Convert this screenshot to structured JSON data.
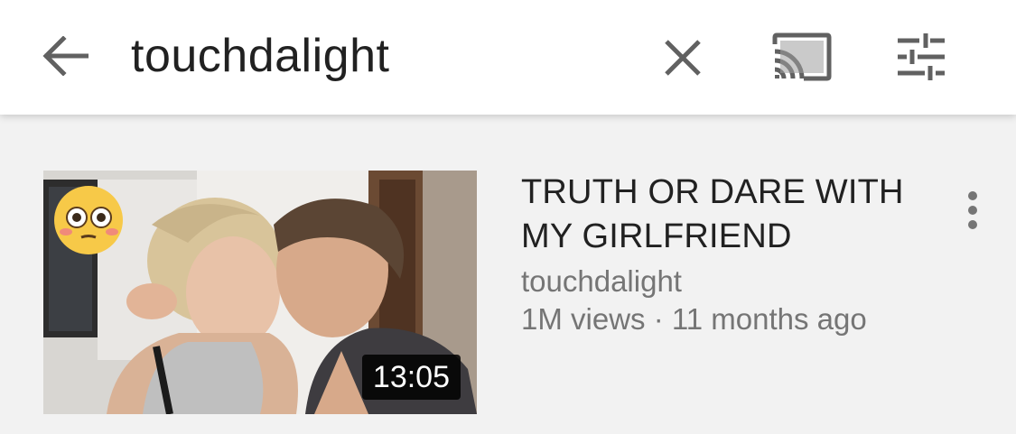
{
  "search": {
    "query": "touchdalight"
  },
  "icons": {
    "back": "arrow-back-icon",
    "clear": "close-icon",
    "cast": "cast-icon",
    "filter": "filter-sliders-icon",
    "more": "more-vert-icon"
  },
  "results": [
    {
      "title_line1": "TRUTH OR DARE WITH",
      "title_line2": "MY GIRLFRIEND",
      "channel": "touchdalight",
      "views": "1M views",
      "separator": "·",
      "age": "11 months ago",
      "duration": "13:05"
    }
  ],
  "colors": {
    "topbar_bg": "#ffffff",
    "page_bg": "#f2f2f2",
    "primary_text": "#212121",
    "secondary_text": "#757575",
    "icon": "#616161"
  }
}
